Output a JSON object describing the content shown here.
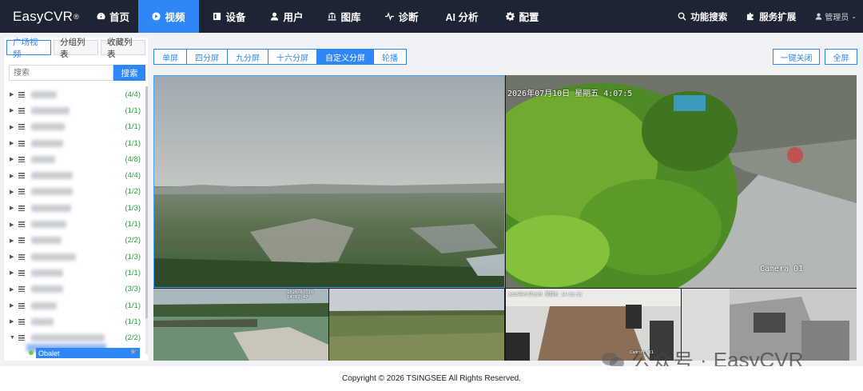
{
  "brand": {
    "name": "EasyCVR",
    "mark": "®"
  },
  "nav": {
    "items": [
      {
        "label": "首页",
        "icon": "dashboard-icon"
      },
      {
        "label": "视频",
        "icon": "play-icon",
        "active": true
      },
      {
        "label": "设备",
        "icon": "device-icon"
      },
      {
        "label": "用户",
        "icon": "user-icon"
      },
      {
        "label": "图库",
        "icon": "gallery-icon"
      },
      {
        "label": "诊断",
        "icon": "pulse-icon"
      },
      {
        "label": "AI 分析",
        "icon": ""
      },
      {
        "label": "配置",
        "icon": "gear-icon"
      }
    ],
    "function_search": "功能搜索",
    "service_ext": "服务扩展",
    "user": "管理员"
  },
  "sidebar": {
    "tabs": [
      "广场视频",
      "分组列表",
      "收藏列表"
    ],
    "search_placeholder": "搜索",
    "search_button": "搜索",
    "devices": [
      {
        "count": "(4/4)"
      },
      {
        "count": "(1/1)"
      },
      {
        "count": "(1/1)"
      },
      {
        "count": "(1/1)"
      },
      {
        "count": "(4/8)"
      },
      {
        "count": "(4/4)"
      },
      {
        "count": "(1/2)"
      },
      {
        "count": "(1/3)"
      },
      {
        "count": "(1/1)"
      },
      {
        "count": "(2/2)"
      },
      {
        "count": "(1/3)"
      },
      {
        "count": "(1/1)"
      },
      {
        "count": "(3/3)"
      },
      {
        "count": "(1/1)"
      },
      {
        "count": "(1/1)"
      },
      {
        "count": "(2/2)"
      }
    ],
    "selected_channel": "Obalet"
  },
  "toolbar": {
    "layouts": [
      "单屏",
      "四分屏",
      "九分屏",
      "十六分屏",
      "自定义分屏",
      "轮播"
    ],
    "active_layout": "自定义分屏",
    "close_all": "一键关闭",
    "fullscreen": "全屏"
  },
  "videos": {
    "tile2_osd": "2026年07月10日 星期五 4:07:5",
    "tile2_camera": "Camera 01",
    "tile3_osd": "2026-07-10 14:02:47",
    "tile5_osd": "2026年07月10日 星期五 14:02:51",
    "tile5_camera": "Camera 01"
  },
  "watermark": {
    "text1": "公众号",
    "dot": "·",
    "text2": "EasyCVR"
  },
  "footer": {
    "copyright": "Copyright © 2026 TSINGSEE All Rights Reserved."
  },
  "colors": {
    "accent": "#2f86f6",
    "nav_bg": "#1d2535",
    "count_green": "#2e9c3c"
  }
}
